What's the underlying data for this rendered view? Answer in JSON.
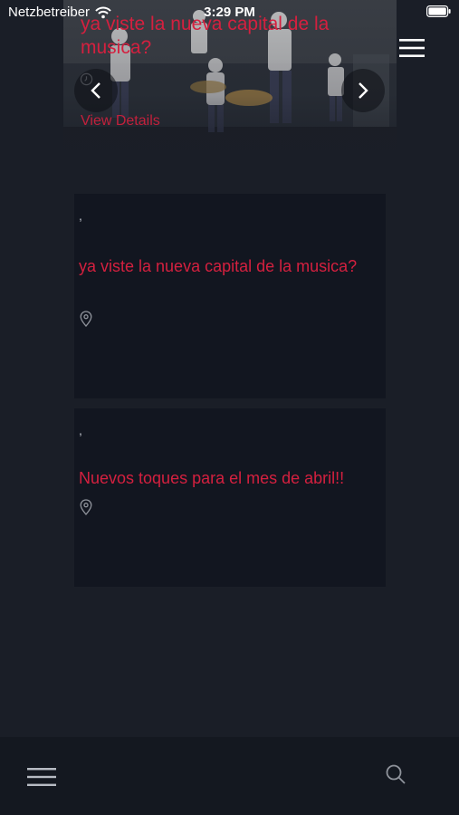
{
  "status_bar": {
    "carrier": "Netzbetreiber",
    "time": "3:29 PM",
    "icons": [
      "wifi-icon",
      "battery-icon"
    ]
  },
  "hero": {
    "title": "ya viste la nueva capital de la musica?",
    "view_details_label": "View Details",
    "icons": [
      "clock-icon",
      "chevron-left-icon",
      "chevron-right-icon",
      "hamburger-menu-icon"
    ]
  },
  "cards": [
    {
      "meta": ",",
      "title": "ya viste la nueva capital de la musica?",
      "icon": "location-pin-icon"
    },
    {
      "meta": ",",
      "title": "Nuevos toques para el mes de abril!!",
      "icon": "location-pin-icon"
    }
  ],
  "bottom_bar": {
    "icons": [
      "hamburger-menu-icon",
      "search-icon"
    ]
  },
  "colors": {
    "accent": "#d4203f",
    "background": "#1a1e27",
    "card": "#121620",
    "bottom_bar": "#141820"
  }
}
